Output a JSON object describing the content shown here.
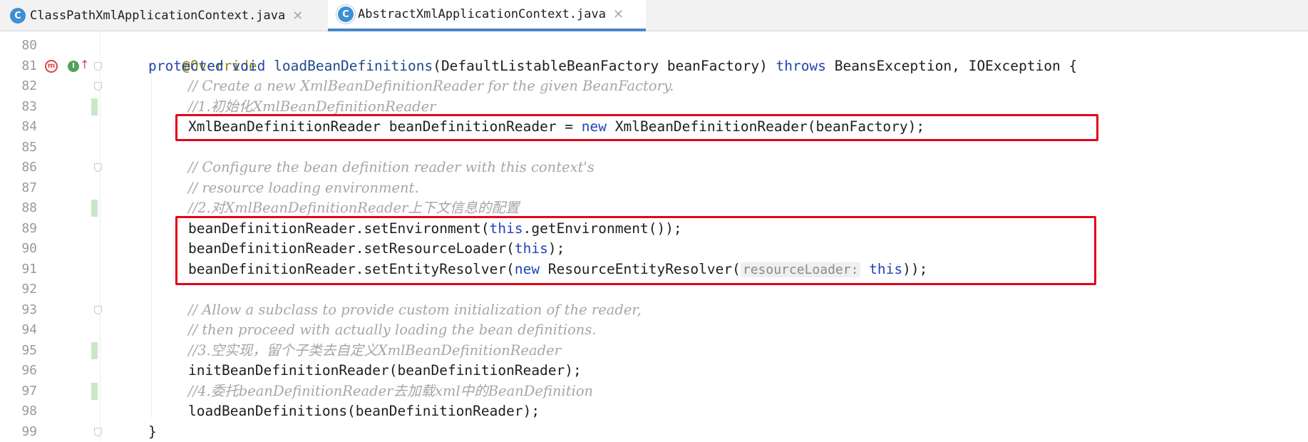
{
  "tabs": [
    {
      "label": "ClassPathXmlApplicationContext.java",
      "icon": "C",
      "active": false
    },
    {
      "label": "AbstractXmlApplicationContext.java",
      "icon": "C",
      "active": true
    }
  ],
  "line_numbers": [
    "80",
    "81",
    "82",
    "83",
    "84",
    "85",
    "86",
    "87",
    "88",
    "89",
    "90",
    "91",
    "92",
    "93",
    "94",
    "95",
    "96",
    "97",
    "98",
    "99"
  ],
  "code": {
    "l80_annotation": "@Override",
    "l81_protected": "protected",
    "l81_void": "void",
    "l81_method": "loadBeanDefinitions",
    "l81_params": "(DefaultListableBeanFactory beanFactory) ",
    "l81_throws": "throws",
    "l81_exceptions": " BeansException, IOException {",
    "l82_comment": "// Create a new XmlBeanDefinitionReader for the given BeanFactory.",
    "l83_comment": "//1.初始化XmlBeanDefinitionReader",
    "l84_pre": "XmlBeanDefinitionReader beanDefinitionReader = ",
    "l84_new": "new",
    "l84_post": " XmlBeanDefinitionReader(beanFactory);",
    "l86_comment": "// Configure the bean definition reader with this context's",
    "l87_comment": "// resource loading environment.",
    "l88_comment": "//2.对XmlBeanDefinitionReader上下文信息的配置",
    "l89_pre": "beanDefinitionReader.setEnvironment(",
    "l89_this": "this",
    "l89_post": ".getEnvironment());",
    "l90_pre": "beanDefinitionReader.setResourceLoader(",
    "l90_this": "this",
    "l90_post": ");",
    "l91_pre": "beanDefinitionReader.setEntityResolver(",
    "l91_new": "new",
    "l91_mid": " ResourceEntityResolver(",
    "l91_hint": "resourceLoader:",
    "l91_this": "this",
    "l91_post": "));",
    "l93_comment": "// Allow a subclass to provide custom initialization of the reader,",
    "l94_comment": "// then proceed with actually loading the bean definitions.",
    "l95_comment": "//3.空实现，留个子类去自定义XmlBeanDefinitionReader",
    "l96_code": "initBeanDefinitionReader(beanDefinitionReader);",
    "l97_comment": "//4.委托beanDefinitionReader去加载xml中的BeanDefinition",
    "l98_code": "loadBeanDefinitions(beanDefinitionReader);",
    "l99_code": "}"
  },
  "gutter_icons": {
    "override_marker": "m",
    "implements_marker": "I"
  },
  "colors": {
    "keyword": "#2244b4",
    "annotation": "#8c8c00",
    "comment": "#a6a6a6",
    "highlight_box": "#e4001b",
    "active_tab_underline": "#4a86c8",
    "class_icon": "#3d8fd6"
  }
}
